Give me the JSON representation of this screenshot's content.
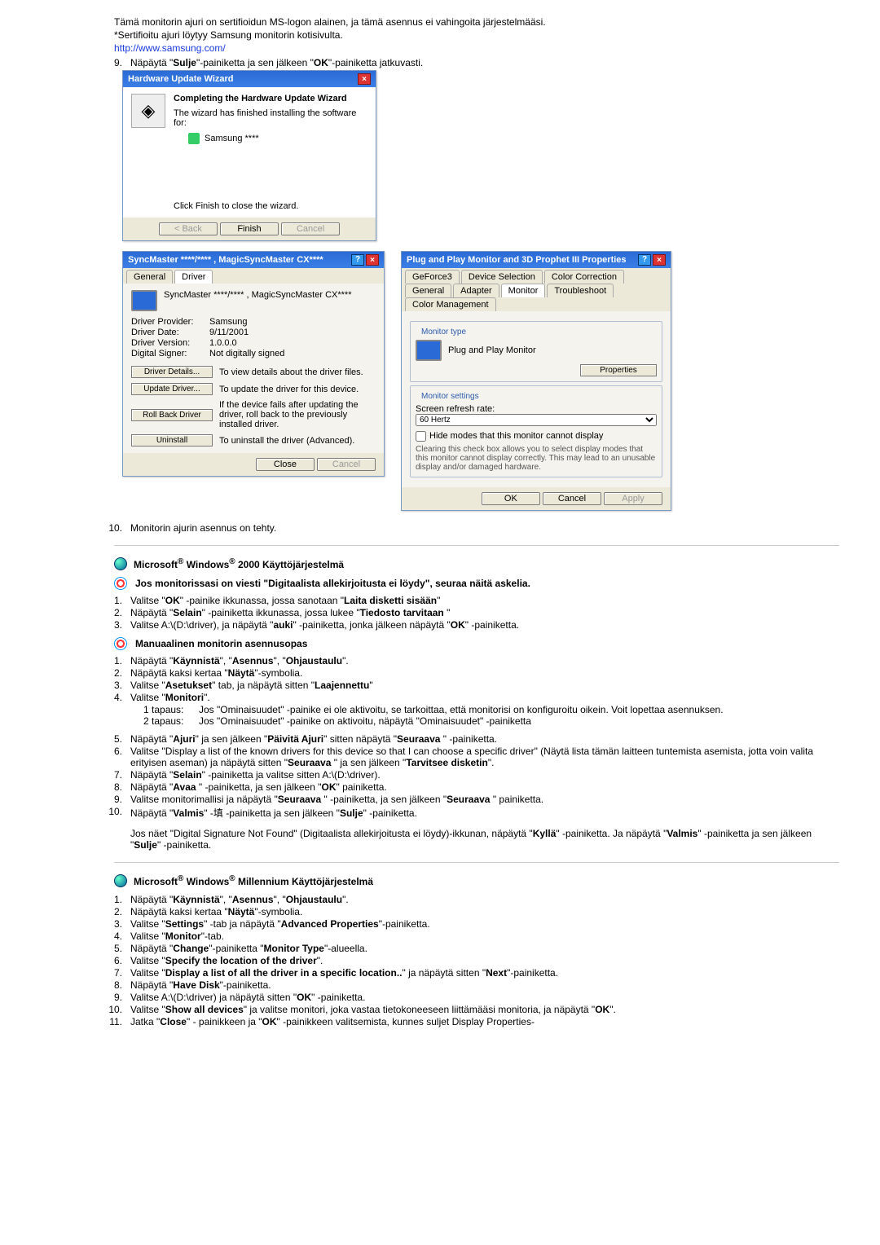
{
  "intro": {
    "line1": "Tämä monitorin ajuri on sertifioidun MS-logon alainen, ja tämä asennus ei vahingoita järjestelmääsi.",
    "line2": "*Sertifioitu ajuri löytyy Samsung monitorin kotisivulta.",
    "url": "http://www.samsung.com/"
  },
  "step9": {
    "num": "9.",
    "text_a": "Näpäytä \"",
    "bold1": "Sulje",
    "text_b": "\"-painiketta ja sen jälkeen \"",
    "bold2": "OK",
    "text_c": "\"-painiketta jatkuvasti."
  },
  "wiz": {
    "title": "Hardware Update Wizard",
    "h": "Completing the Hardware Update Wizard",
    "line1": "The wizard has finished installing the software for:",
    "line2": "Samsung ****",
    "line3": "Click Finish to close the wizard.",
    "back": "< Back",
    "finish": "Finish",
    "cancel": "Cancel"
  },
  "drv": {
    "title": "SyncMaster ****/**** , MagicSyncMaster CX****",
    "tab_general": "General",
    "tab_driver": "Driver",
    "name": "SyncMaster ****/**** , MagicSyncMaster CX****",
    "f1l": "Driver Provider:",
    "f1v": "Samsung",
    "f2l": "Driver Date:",
    "f2v": "9/11/2001",
    "f3l": "Driver Version:",
    "f3v": "1.0.0.0",
    "f4l": "Digital Signer:",
    "f4v": "Not digitally signed",
    "b1": "Driver Details...",
    "b1t": "To view details about the driver files.",
    "b2": "Update Driver...",
    "b2t": "To update the driver for this device.",
    "b3": "Roll Back Driver",
    "b3t": "If the device fails after updating the driver, roll back to the previously installed driver.",
    "b4": "Uninstall",
    "b4t": "To uninstall the driver (Advanced).",
    "close": "Close",
    "cancel": "Cancel"
  },
  "pnp": {
    "title": "Plug and Play Monitor and 3D Prophet III Properties",
    "tabs": [
      "GeForce3",
      "Device Selection",
      "Color Correction",
      "General",
      "Adapter",
      "Monitor",
      "Troubleshoot",
      "Color Management"
    ],
    "grp1": "Monitor type",
    "mon": "Plug and Play Monitor",
    "props": "Properties",
    "grp2": "Monitor settings",
    "rate": "Screen refresh rate:",
    "hz": "60 Hertz",
    "chk": "Hide modes that this monitor cannot display",
    "note": "Clearing this check box allows you to select display modes that this monitor cannot display correctly. This may lead to an unusable display and/or damaged hardware.",
    "ok": "OK",
    "cancel": "Cancel",
    "apply": "Apply"
  },
  "step10": {
    "num": "10.",
    "text": "Monitorin ajurin asennus on tehty."
  },
  "win2000": {
    "head_a": "Microsoft",
    "head_b": " Windows",
    "head_c": " 2000 Käyttöjärjestelmä",
    "note": "Jos monitorissasi on viesti \"Digitaalista allekirjoitusta ei löydy\", seuraa näitä askelia.",
    "s1n": "1.",
    "s1a": "Valitse \"",
    "s1b": "OK",
    "s1c": "\" -painike ikkunassa, jossa sanotaan \"",
    "s1d": "Laita disketti sisään",
    "s1e": "\"",
    "s2n": "2.",
    "s2a": "Näpäytä \"",
    "s2b": "Selain",
    "s2c": "\" -painiketta ikkunassa, jossa lukee \"",
    "s2d": "Tiedosto tarvitaan",
    "s2e": " \"",
    "s3n": "3.",
    "s3a": "Valitse A:\\(D:\\driver), ja näpäytä \"",
    "s3b": "auki",
    "s3c": "\" -painiketta, jonka jälkeen näpäytä \"",
    "s3d": "OK",
    "s3e": "\" -painiketta.",
    "man": "Manuaalinen monitorin asennusopas",
    "m1n": "1.",
    "m1": "Näpäytä \"Käynnistä\", \"Asennus\", \"Ohjaustaulu\".",
    "m2n": "2.",
    "m2": "Näpäytä kaksi kertaa \"Näytä\"-symbolia.",
    "m3n": "3.",
    "m3": "Valitse \"Asetukset\" tab, ja näpäytä sitten \"Laajennettu\"",
    "m4n": "4.",
    "m4": "Valitse \"Monitori\".",
    "m4c1l": "1 tapaus:",
    "m4c1": "Jos \"Ominaisuudet\" -painike ei ole aktivoitu, se tarkoittaa, että monitorisi on konfiguroitu oikein. Voit lopettaa asennuksen.",
    "m4c2l": "2 tapaus:",
    "m4c2": "Jos \"Ominaisuudet\" -painike on aktivoitu, näpäytä \"Ominaisuudet\" -painiketta",
    "m5n": "5.",
    "m5": "Näpäytä \"Ajuri\" ja sen jälkeen \"Päivitä Ajuri\" sitten näpäytä \"Seuraava \" -painiketta.",
    "m6n": "6.",
    "m6": "Valitse \"Display a list of the known drivers for this device so that I can choose a specific driver\" (Näytä lista tämän laitteen tuntemista asemista, jotta voin valita erityisen aseman) ja näpäytä sitten \"Seuraava \" ja sen jälkeen \"Tarvitsee disketin\".",
    "m7n": "7.",
    "m7": "Näpäytä \"Selain\" -painiketta ja valitse sitten A:\\(D:\\driver).",
    "m8n": "8.",
    "m8": "Näpäytä \"Avaa \" -painiketta, ja sen jälkeen \"OK\" painiketta.",
    "m9n": "9.",
    "m9": "Valitse monitorimallisi ja näpäytä \"Seuraava \" -painiketta, ja sen jälkeen \"Seuraava \" painiketta.",
    "m10n": "10.",
    "m10": "Näpäytä \"Valmis\" -painiketta ja sen jälkeen \"Sulje\" -painiketta.",
    "m_note": "Jos näet \"Digital Signature Not Found\" (Digitaalista allekirjoitusta ei löydy)-ikkunan, näpäytä \"Kyllä\" -painiketta. Ja näpäytä \"Valmis\" -painiketta ja sen jälkeen \"Sulje\" -painiketta."
  },
  "winme": {
    "head_a": "Microsoft",
    "head_b": " Windows",
    "head_c": " Millennium Käyttöjärjestelmä",
    "s1n": "1.",
    "s1": "Näpäytä \"Käynnistä\", \"Asennus\", \"Ohjaustaulu\".",
    "s2n": "2.",
    "s2": "Näpäytä kaksi kertaa \"Näytä\"-symbolia.",
    "s3n": "3.",
    "s3": "Valitse \"Settings\" -tab ja näpäytä \"Advanced Properties\"-painiketta.",
    "s4n": "4.",
    "s4": "Valitse \"Monitor\"-tab.",
    "s5n": "5.",
    "s5": "Näpäytä \"Change\"-painiketta \"Monitor Type\"-alueella.",
    "s6n": "6.",
    "s6": "Valitse \"Specify the location of the driver\".",
    "s7n": "7.",
    "s7": "Valitse \"Display a list of all the driver in a specific location..\" ja näpäytä sitten \"Next\"-painiketta.",
    "s8n": "8.",
    "s8": "Näpäytä \"Have Disk\"-painiketta.",
    "s9n": "9.",
    "s9": "Valitse A:\\(D:\\driver) ja näpäytä sitten \"OK\" -painiketta.",
    "s10n": "10.",
    "s10": "Valitse \"Show all devices\" ja valitse monitori, joka vastaa tietokoneeseen liittämääsi monitoria, ja näpäytä \"OK\".",
    "s11n": "11.",
    "s11": "Jatka \"Close\" - painikkeen ja \"OK\" -painikkeen valitsemista, kunnes suljet Display Properties-"
  }
}
